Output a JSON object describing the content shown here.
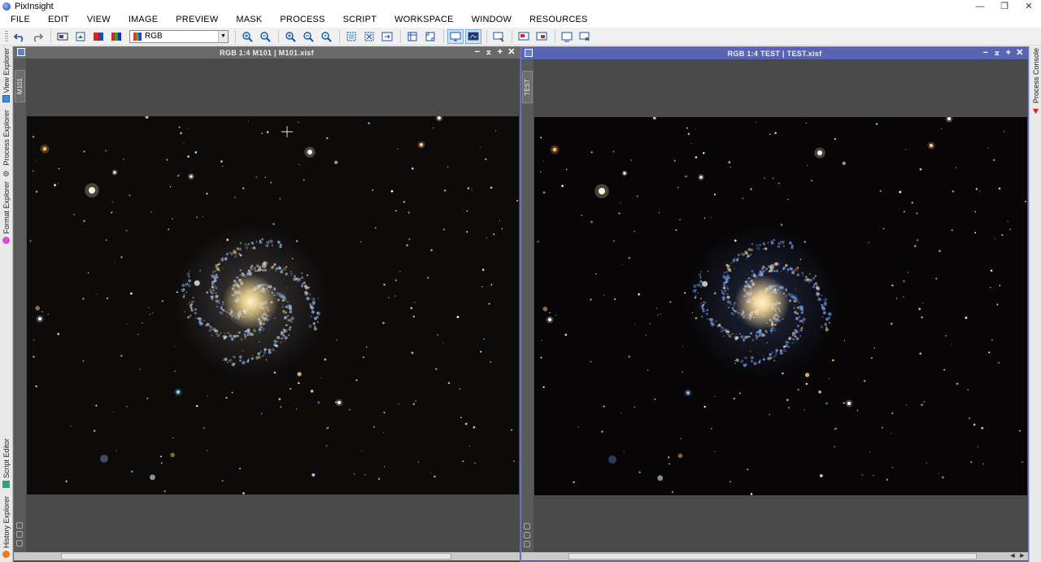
{
  "app": {
    "title": "PixInsight"
  },
  "window_controls": {
    "minimize": "—",
    "maximize": "❐",
    "close": "✕"
  },
  "menu": [
    "FILE",
    "EDIT",
    "VIEW",
    "IMAGE",
    "PREVIEW",
    "MASK",
    "PROCESS",
    "SCRIPT",
    "WORKSPACE",
    "WINDOW",
    "RESOURCES"
  ],
  "toolbar": {
    "channel_select": {
      "value": "RGB"
    },
    "buttons": [
      "undo-icon",
      "redo-icon",
      "image-properties-icon",
      "new-image-icon",
      "channel-red-icon",
      "channel-alpha-icon",
      "zoom-in-icon",
      "zoom-out-icon",
      "zoom-in-2-icon",
      "zoom-out-2-icon",
      "zoom-1-1-icon",
      "fit-view-icon",
      "fit-window-icon",
      "pan-icon",
      "zoom-tool-icon",
      "readout-icon",
      "display-stf-icon",
      "display-screen-icon",
      "new-preview-icon",
      "mask-show-icon",
      "mask-invert-icon",
      "workspace-icon",
      "link-icon"
    ]
  },
  "side_left": {
    "tabs": [
      {
        "label": "View Explorer",
        "icon": "view-explorer-icon",
        "color": "#3a8ee6"
      },
      {
        "label": "Process Explorer",
        "icon": "gear-icon",
        "color": "#333333"
      },
      {
        "label": "Format Explorer",
        "icon": "format-icon",
        "color": "#e04ad0"
      },
      {
        "label": "Script Editor",
        "icon": "script-icon",
        "color": "#2aa57a"
      },
      {
        "label": "History Explorer",
        "icon": "history-icon",
        "color": "#f07a1a"
      }
    ]
  },
  "side_right": {
    "tabs": [
      {
        "label": "Process Console",
        "icon": "console-icon",
        "color": "#d22"
      }
    ]
  },
  "windows": [
    {
      "title": "RGB 1:4 M101 | M101.xisf",
      "view_id": "M101",
      "active": false
    },
    {
      "title": "RGB 1:4 TEST | TEST.xisf",
      "view_id": "TEST",
      "active": true
    }
  ],
  "window_buttons": {
    "shade": "−",
    "iconize": "⌅",
    "maximize": "+",
    "close": "✕"
  },
  "colors": {
    "workspace": "#6e6e6e",
    "active_title": "#5a64b4",
    "inactive_title": "#6a6a6a",
    "sky": "#070506"
  }
}
